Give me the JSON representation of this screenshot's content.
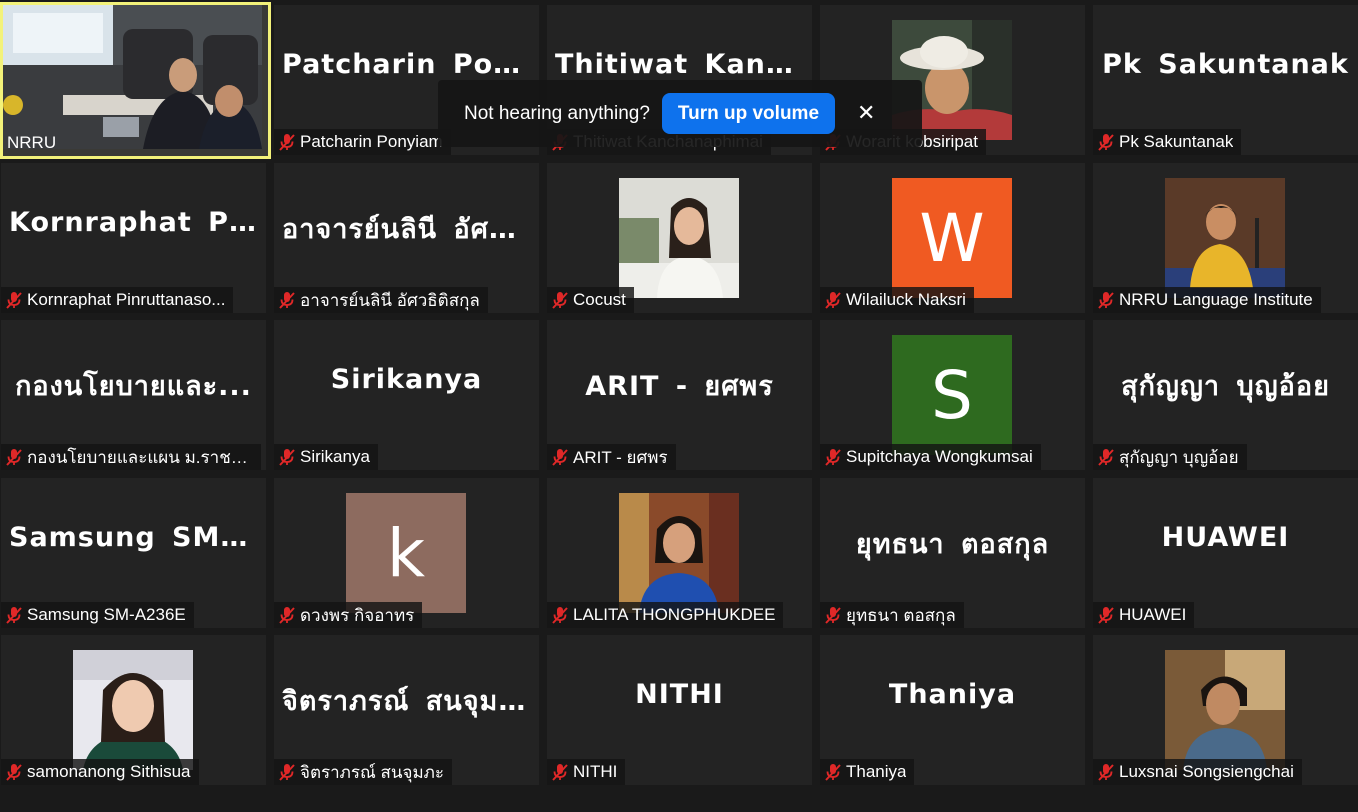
{
  "toast": {
    "message": "Not hearing anything?",
    "button_label": "Turn up volume",
    "close_glyph": "✕"
  },
  "icons": {
    "muted": "mic-muted-icon",
    "close": "close-icon"
  },
  "colors": {
    "active_border": "#f3f27a",
    "button_blue": "#0e72ed",
    "muted_red": "#e02828"
  },
  "participants": [
    {
      "label": "NRRU",
      "kind": "video",
      "active": true
    },
    {
      "label": "Patcharin Ponyiam",
      "kind": "name",
      "display": "Patcharin  Ponyi..."
    },
    {
      "label": "Thitiwat Kanchanaphimai",
      "kind": "name",
      "display": "Thitiwat  Kanch..."
    },
    {
      "label": "Worarit kobsiripat",
      "kind": "photo",
      "photo": "hat-man"
    },
    {
      "label": "Pk Sakuntanak",
      "kind": "name",
      "display": "Pk Sakuntanak"
    },
    {
      "label": "Kornraphat Pinruttanaso...",
      "kind": "name",
      "display": "Kornraphat  Pinr..."
    },
    {
      "label": "อาจารย์นลินี อัศวธิติสกุล",
      "kind": "name",
      "display": "อาจารย์นลินี อัศว..."
    },
    {
      "label": "Cocust",
      "kind": "photo",
      "photo": "woman-white"
    },
    {
      "label": "Wilailuck Naksri",
      "kind": "avatar",
      "letter": "W",
      "color": "#f05a22"
    },
    {
      "label": "NRRU Language Institute",
      "kind": "photo",
      "photo": "speaker-yellow"
    },
    {
      "label": "กองนโยบายและแผน ม.ราชภัฏ...",
      "kind": "name",
      "display": "กองนโยบายและ..."
    },
    {
      "label": "Sirikanya",
      "kind": "name",
      "display": "Sirikanya"
    },
    {
      "label": "ARIT - ยศพร",
      "kind": "name",
      "display": "ARIT - ยศพร"
    },
    {
      "label": "Supitchaya Wongkumsai",
      "kind": "avatar",
      "letter": "S",
      "color": "#2e6a1f"
    },
    {
      "label": "สุกัญญา  บุญอ้อย",
      "kind": "name",
      "display": "สุกัญญา  บุญอ้อย"
    },
    {
      "label": "Samsung SM-A236E",
      "kind": "name",
      "display": "Samsung  SM-A..."
    },
    {
      "label": "ดวงพร กิจอาทร",
      "kind": "avatar",
      "letter": "k",
      "color": "#8d6b5f"
    },
    {
      "label": "LALITA THONGPHUKDEE",
      "kind": "photo",
      "photo": "woman-blue"
    },
    {
      "label": "ยุทธนา  ตอสกุล",
      "kind": "name",
      "display": "ยุทธนา  ตอสกุล"
    },
    {
      "label": "HUAWEI",
      "kind": "name",
      "display": "HUAWEI"
    },
    {
      "label": "samonanong Sithisua",
      "kind": "photo",
      "photo": "woman-selfie"
    },
    {
      "label": "จิตราภรณ์  สนจุมภะ",
      "kind": "name",
      "display": "จิตราภรณ์  สนจุม..."
    },
    {
      "label": "NITHI",
      "kind": "name",
      "display": "NITHI"
    },
    {
      "label": "Thaniya",
      "kind": "name",
      "display": "Thaniya"
    },
    {
      "label": "Luxsnai Songsiengchai",
      "kind": "photo",
      "photo": "woman-short-hair"
    }
  ]
}
